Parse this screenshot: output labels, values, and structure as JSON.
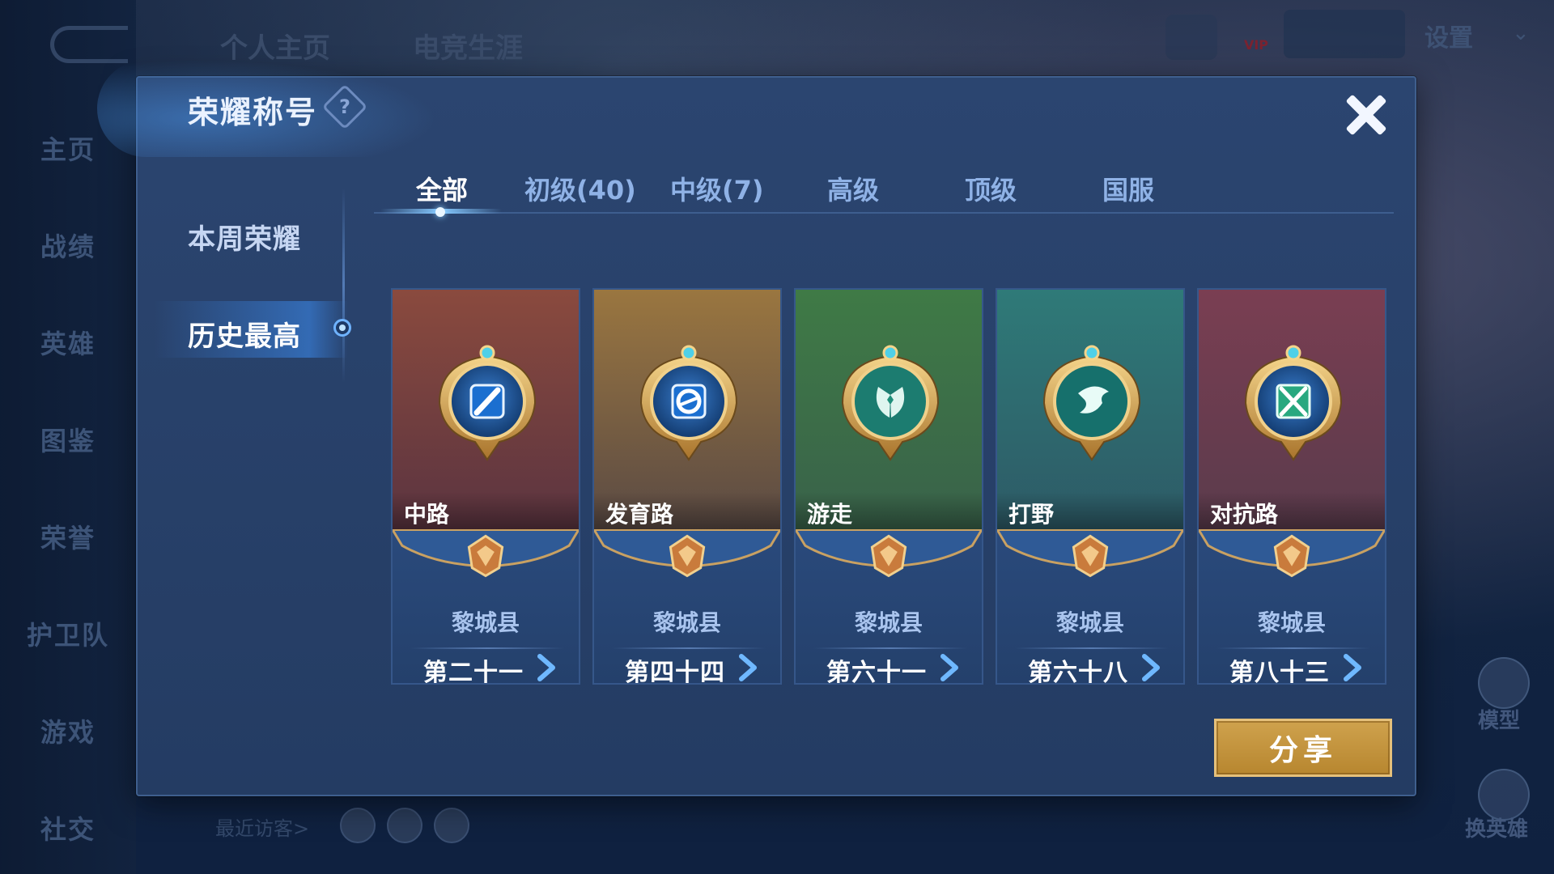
{
  "background": {
    "top_tabs": [
      "个人主页",
      "电竞生涯"
    ],
    "settings_label": "设置",
    "vip_label": "VIP",
    "left_nav": [
      "主页",
      "战绩",
      "英雄",
      "图鉴",
      "荣誉",
      "护卫队",
      "游戏",
      "社交"
    ],
    "recent_visitors_label": "最近访客>",
    "right_side": [
      "模型",
      "换英雄"
    ]
  },
  "modal": {
    "title": "荣耀称号",
    "help_symbol": "?",
    "side_tabs": [
      {
        "label": "本周荣耀",
        "active": false
      },
      {
        "label": "历史最高",
        "active": true
      }
    ],
    "tabs": [
      {
        "label": "全部",
        "active": true
      },
      {
        "label": "初级(40)",
        "active": false
      },
      {
        "label": "中级(7)",
        "active": false
      },
      {
        "label": "高级",
        "active": false
      },
      {
        "label": "顶级",
        "active": false
      },
      {
        "label": "国服",
        "active": false
      }
    ],
    "cards": [
      {
        "role": "中路",
        "region": "黎城县",
        "rank": "第二十一",
        "icon": "sword-emblem-icon",
        "color_top": "#8a4a3e",
        "color_bottom": "#5b3440"
      },
      {
        "role": "发育路",
        "region": "黎城县",
        "rank": "第四十四",
        "icon": "marksman-emblem-icon",
        "color_top": "#9a7640",
        "color_bottom": "#5a4a44"
      },
      {
        "role": "游走",
        "region": "黎城县",
        "rank": "第六十一",
        "icon": "wings-emblem-icon",
        "color_top": "#3f7a46",
        "color_bottom": "#39624a"
      },
      {
        "role": "打野",
        "region": "黎城县",
        "rank": "第六十八",
        "icon": "dragon-emblem-icon",
        "color_top": "#2f7a78",
        "color_bottom": "#2d5a66"
      },
      {
        "role": "对抗路",
        "region": "黎城县",
        "rank": "第八十三",
        "icon": "crossed-swords-emblem-icon",
        "color_top": "#7a3e52",
        "color_bottom": "#5a3b4c"
      }
    ],
    "share_label": "分享",
    "close_icon": "close-icon"
  }
}
